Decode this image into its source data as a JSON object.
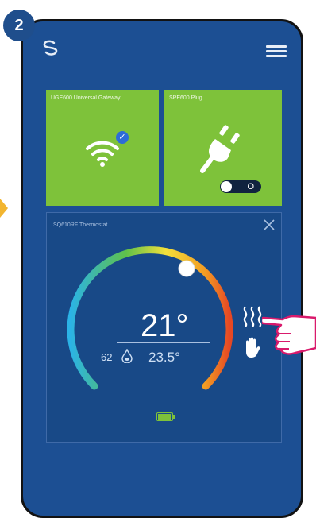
{
  "step_number": "2",
  "header": {
    "logo_icon": "salus-logo-icon",
    "menu_icon": "hamburger-menu-icon"
  },
  "tiles": [
    {
      "label": "UGE600 Universal Gateway",
      "icon": "wifi-connected-icon",
      "status_icon": "check-icon"
    },
    {
      "label": "SPE600 Plug",
      "icon": "plug-icon",
      "toggle_label": "O",
      "toggle_state": "off"
    }
  ],
  "thermostat": {
    "title": "SQ610RF Thermostat",
    "setpoint": "21°",
    "humidity": "62",
    "room_temp": "23.5°",
    "heating_icon": "heating-waves-icon",
    "manual_mode_icon": "hand-icon",
    "battery_icon": "battery-full-icon",
    "close_icon": "close-icon"
  },
  "colors": {
    "background": "#1c4f93",
    "tile_green": "#7ec23a",
    "card": "#184987",
    "badge": "#1f4e8c"
  }
}
